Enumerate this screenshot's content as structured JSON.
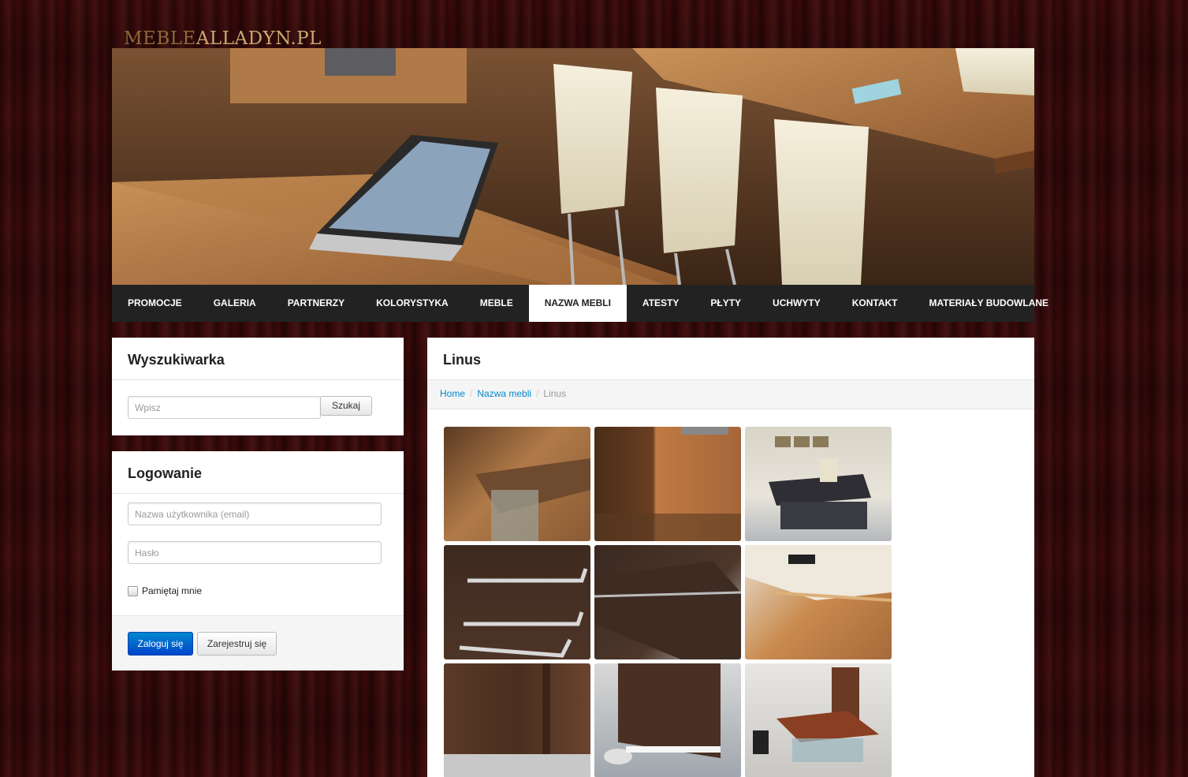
{
  "header": {
    "logo_a": "MEBLE",
    "logo_b": "ALLADYN.PL"
  },
  "nav": {
    "items": [
      {
        "label": "PROMOCJE"
      },
      {
        "label": "GALERIA"
      },
      {
        "label": "PARTNERZY"
      },
      {
        "label": "KOLORYSTYKA"
      },
      {
        "label": "MEBLE"
      },
      {
        "label": "NAZWA MEBLI",
        "active": true
      },
      {
        "label": "ATESTY"
      },
      {
        "label": "PŁYTY"
      },
      {
        "label": "UCHWYTY"
      },
      {
        "label": "KONTAKT"
      },
      {
        "label": "MATERIAŁY BUDOWLANE"
      }
    ]
  },
  "search": {
    "title": "Wyszukiwarka",
    "placeholder": "Wpisz",
    "button": "Szukaj"
  },
  "login": {
    "title": "Logowanie",
    "username_placeholder": "Nazwa użytkownika (email)",
    "password_placeholder": "Hasło",
    "remember_label": "Pamiętaj mnie",
    "login_button": "Zaloguj się",
    "register_button": "Zarejestruj się"
  },
  "content": {
    "title": "Linus",
    "breadcrumb": [
      "Home",
      "Nazwa mebli",
      "Linus"
    ]
  }
}
